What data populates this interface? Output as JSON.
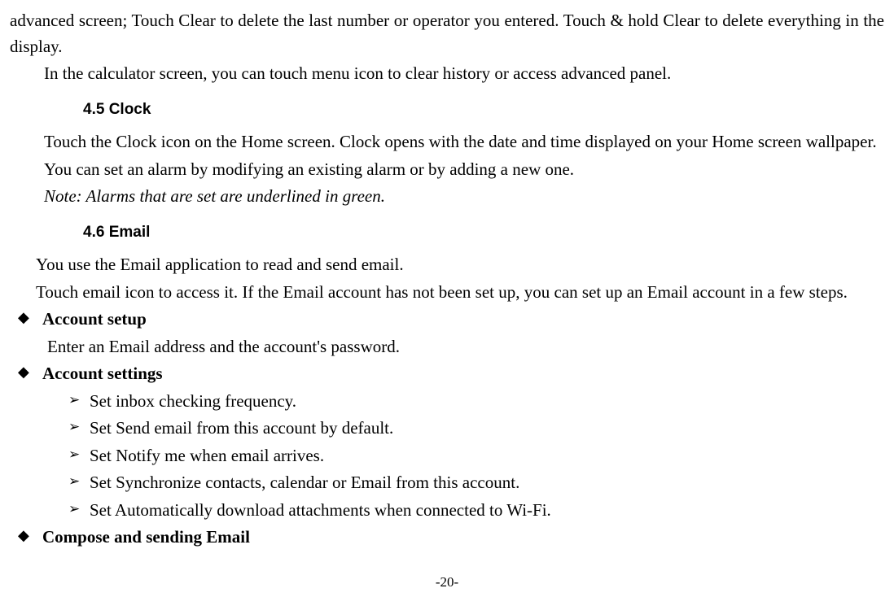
{
  "para1": "advanced screen; Touch Clear to delete the last number or operator you entered. Touch & hold Clear to delete everything in the display.",
  "para2": "In the calculator screen, you can touch menu icon to clear history or access advanced panel.",
  "section45": "4.5    Clock",
  "para3": "Touch the Clock icon on the Home screen. Clock opens with the date and time displayed on your Home screen wallpaper.",
  "para4": "You can set an alarm by modifying an existing alarm or by adding a new one.",
  "para5": "Note: Alarms that are set are underlined in green.",
  "section46": "4.6    Email",
  "para6": "You use the Email application to read and send email.",
  "para7": "Touch email icon to access it. If the Email account has not been set up, you can set up an Email account in a few steps.",
  "bullets": {
    "b1_title": "Account setup",
    "b1_body": "Enter an Email address and the account's password.",
    "b2_title": "Account settings",
    "b2_sub1": "Set inbox checking frequency.",
    "b2_sub2": "Set Send email from this account by default.",
    "b2_sub3": "Set Notify me when email arrives.",
    "b2_sub4": "Set Synchronize contacts, calendar or Email from this account.",
    "b2_sub5": "Set Automatically download attachments when connected to Wi-Fi.",
    "b3_title": "Compose and sending Email"
  },
  "pageNumber": "-20-"
}
